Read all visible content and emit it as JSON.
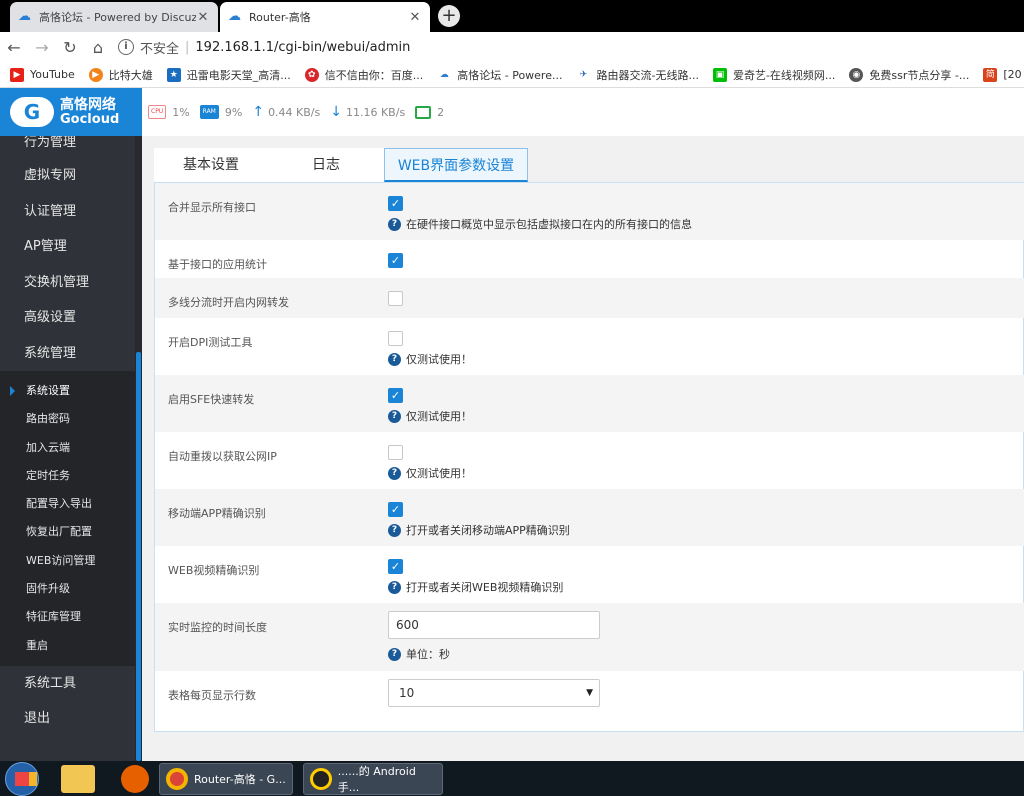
{
  "browser": {
    "tabs": [
      {
        "title": "高恪论坛 - Powered by Discuz!",
        "active": false
      },
      {
        "title": "Router-高恪",
        "active": true
      }
    ],
    "new_tab": "+",
    "close": "✕",
    "address": {
      "security": "不安全",
      "url": "192.168.1.1/cgi-bin/webui/admin"
    },
    "bookmarks": [
      {
        "label": "YouTube",
        "icon": "youtube-icon",
        "color": "#e62117"
      },
      {
        "label": "比特大雄",
        "icon": "play-icon",
        "color": "#f2831a"
      },
      {
        "label": "迅雷电影天堂_高清...",
        "icon": "bookmark-icon",
        "color": "#1a6ec0"
      },
      {
        "label": "信不信由你：百度...",
        "icon": "huawei-icon",
        "color": "#d8282b"
      },
      {
        "label": "高恪论坛 - Powere...",
        "icon": "cloud-icon",
        "color": "#2a7ed3"
      },
      {
        "label": "路由器交流-无线路...",
        "icon": "router-icon",
        "color": "#2566b5"
      },
      {
        "label": "爱奇艺-在线视频网...",
        "icon": "iqiyi-icon",
        "color": "#00be06"
      },
      {
        "label": "免费ssr节点分享 -...",
        "icon": "globe-icon",
        "color": "#555555"
      },
      {
        "label": "[20",
        "icon": "jian-icon",
        "color": "#d9441d"
      }
    ]
  },
  "app": {
    "logo": {
      "cn": "高恪网络",
      "en": "Gocloud"
    },
    "status": {
      "cpu_label": "CPU",
      "cpu": "1%",
      "ram_label": "RAM",
      "ram": "9%",
      "upload": "0.44 KB/s",
      "download": "11.16 KB/s",
      "devices": "2"
    },
    "menu": [
      "行为管理",
      "虚拟专网",
      "认证管理",
      "AP管理",
      "交换机管理",
      "高级设置",
      "系统管理"
    ],
    "submenu": [
      "系统设置",
      "路由密码",
      "加入云端",
      "定时任务",
      "配置导入导出",
      "恢复出厂配置",
      "WEB访问管理",
      "固件升级",
      "特征库管理",
      "重启"
    ],
    "menu_bottom": [
      "系统工具",
      "退出"
    ],
    "tabs": [
      "基本设置",
      "日志",
      "WEB界面参数设置"
    ],
    "settings": [
      {
        "label": "合并显示所有接口",
        "checked": true,
        "help": "在硬件接口概览中显示包括虚拟接口在内的所有接口的信息"
      },
      {
        "label": "基于接口的应用统计",
        "checked": true,
        "help": ""
      },
      {
        "label": "多线分流时开启内网转发",
        "checked": false,
        "help": ""
      },
      {
        "label": "开启DPI测试工具",
        "checked": false,
        "help": "仅测试使用！"
      },
      {
        "label": "启用SFE快速转发",
        "checked": true,
        "help": "仅测试使用！"
      },
      {
        "label": "自动重拨以获取公网IP",
        "checked": false,
        "help": "仅测试使用！"
      },
      {
        "label": "移动端APP精确识别",
        "checked": true,
        "help": "打开或者关闭移动端APP精确识别"
      },
      {
        "label": "WEB视频精确识别",
        "checked": true,
        "help": "打开或者关闭WEB视频精确识别"
      }
    ],
    "monitor": {
      "label": "实时监控的时间长度",
      "value": "600",
      "help": "单位：秒"
    },
    "rows_per_page": {
      "label": "表格每页显示行数",
      "value": "10"
    }
  },
  "taskbar": {
    "chrome": "Router-高恪 - G...",
    "qq": "......的 Android手..."
  }
}
